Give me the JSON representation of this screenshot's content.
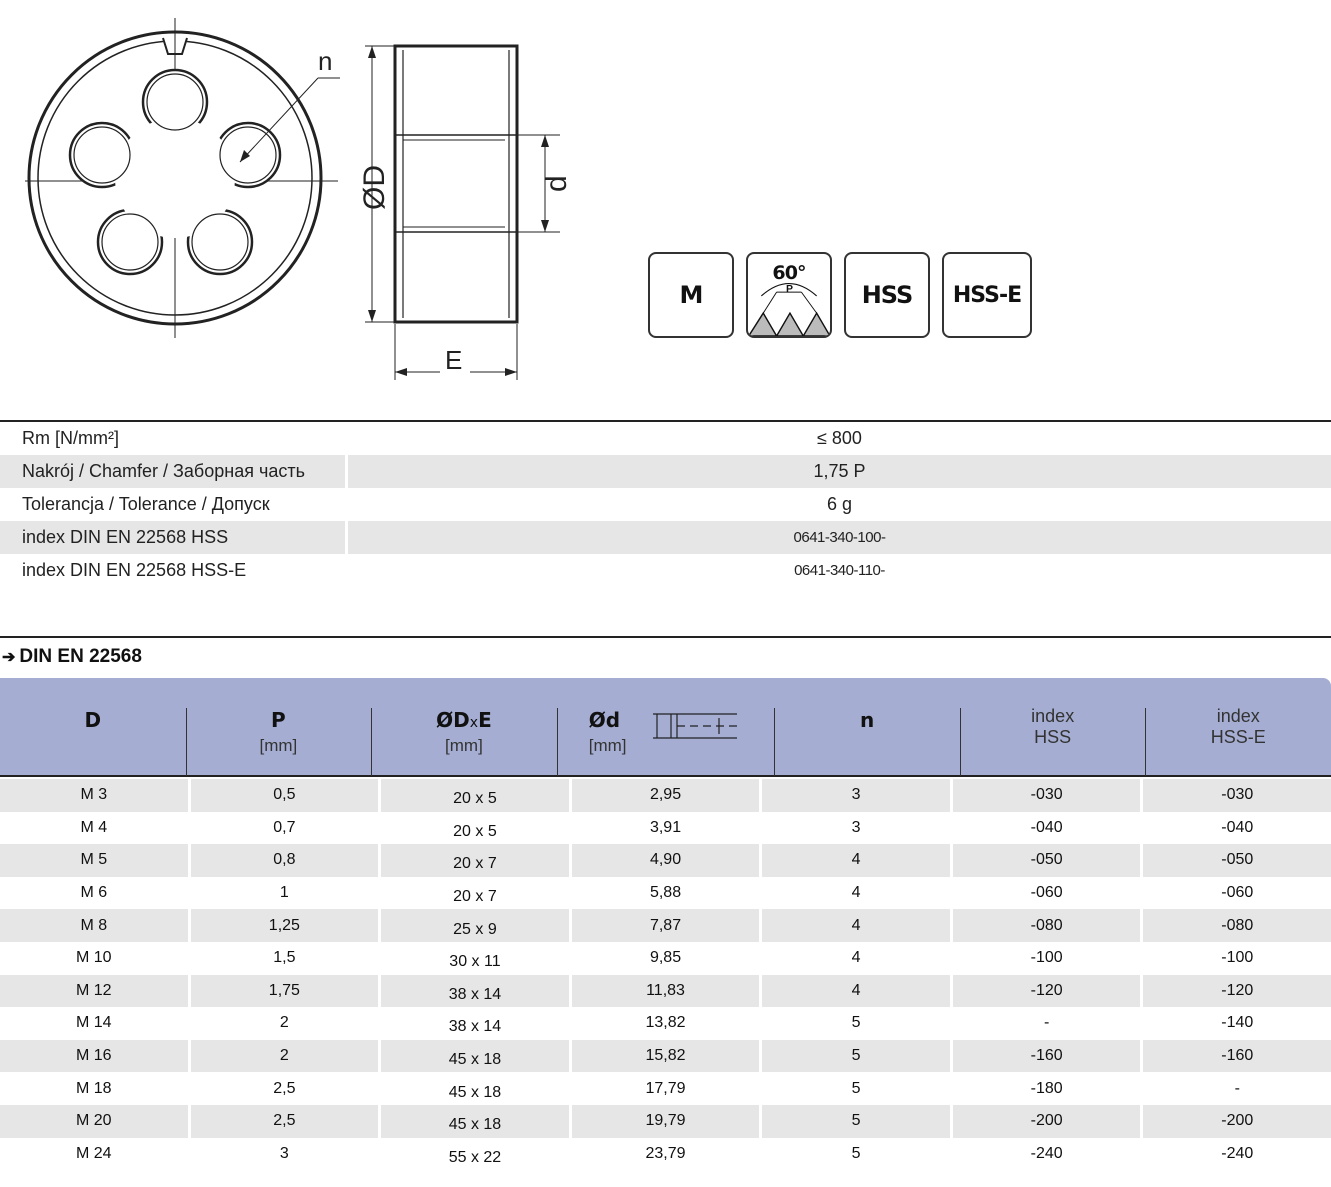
{
  "drawing": {
    "label_n": "n",
    "label_OD": "ØD",
    "label_d": "d",
    "label_E": "E"
  },
  "badges": {
    "thread_type": "M",
    "angle": "60°",
    "pitch": "P",
    "material_1": "HSS",
    "material_2": "HSS-E"
  },
  "properties": [
    {
      "label": "Rm [N/mm²]",
      "value": "≤ 800"
    },
    {
      "label": "Nakrój / Chamfer / Заборная часть",
      "value": "1,75 P"
    },
    {
      "label": "Tolerancja / Tolerance / Допуск",
      "value": "6 g"
    },
    {
      "label": "index DIN EN 22568 HSS",
      "value": "0641-340-100-"
    },
    {
      "label": "index DIN EN 22568 HSS-E",
      "value": "0641-340-110-"
    }
  ],
  "standard": {
    "arrow": "➔",
    "title": "DIN EN 22568"
  },
  "table": {
    "headers": {
      "D": "D",
      "P": "P",
      "P_unit": "[mm]",
      "ODE_D": "ØD",
      "ODE_x": "x",
      "ODE_E": "E",
      "ODE_unit": "[mm]",
      "d": "Ød",
      "d_unit": "[mm]",
      "n": "n",
      "hss_1": "index",
      "hss_2": "HSS",
      "hsse_1": "index",
      "hsse_2": "HSS-E"
    },
    "rows": [
      [
        "M 3",
        "0,5",
        "20 x 5",
        "2,95",
        "3",
        "-030",
        "-030"
      ],
      [
        "M 4",
        "0,7",
        "20 x 5",
        "3,91",
        "3",
        "-040",
        "-040"
      ],
      [
        "M 5",
        "0,8",
        "20 x 7",
        "4,90",
        "4",
        "-050",
        "-050"
      ],
      [
        "M 6",
        "1",
        "20 x 7",
        "5,88",
        "4",
        "-060",
        "-060"
      ],
      [
        "M 8",
        "1,25",
        "25 x 9",
        "7,87",
        "4",
        "-080",
        "-080"
      ],
      [
        "M 10",
        "1,5",
        "30 x 11",
        "9,85",
        "4",
        "-100",
        "-100"
      ],
      [
        "M 12",
        "1,75",
        "38 x 14",
        "11,83",
        "4",
        "-120",
        "-120"
      ],
      [
        "M 14",
        "2",
        "38 x 14",
        "13,82",
        "5",
        "-",
        "-140"
      ],
      [
        "M 16",
        "2",
        "45 x 18",
        "15,82",
        "5",
        "-160",
        "-160"
      ],
      [
        "M 18",
        "2,5",
        "45 x 18",
        "17,79",
        "5",
        "-180",
        "-"
      ],
      [
        "M 20",
        "2,5",
        "45 x 18",
        "19,79",
        "5",
        "-200",
        "-200"
      ],
      [
        "M 24",
        "3",
        "55 x 22",
        "23,79",
        "5",
        "-240",
        "-240"
      ]
    ]
  }
}
